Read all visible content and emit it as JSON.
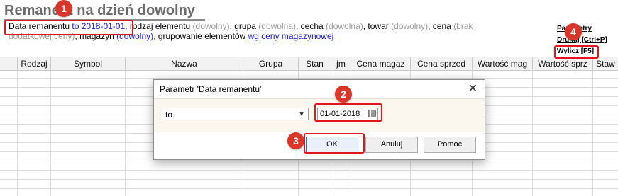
{
  "page": {
    "title": "Remanent na dzień dowolny"
  },
  "filters": {
    "date_label": "Data remanentu",
    "date_value": "to 2018-01-01",
    "rodzaj_label": "rodzaj elementu",
    "rodzaj_value": "(dowolny)",
    "grupa_label": "grupa",
    "grupa_value": "(dowolna)",
    "cecha_label": "cecha",
    "cecha_value": "(dowolna)",
    "towar_label": "towar",
    "towar_value": "(dowolny)",
    "cena_label": "cena",
    "cena_value": "(brak dodatkowej ceny)",
    "magazyn_label": "magazyn",
    "magazyn_value": "(dowolny)",
    "grupowanie_label": "grupowanie elementów",
    "grupowanie_value": "wg ceny magazynowej"
  },
  "actions": {
    "parametry": "Parametry",
    "drukuj": "Drukuj [Ctrl+P]",
    "wylicz": "Wylicz [F5]"
  },
  "table": {
    "columns": [
      "Rodzaj",
      "Symbol",
      "Nazwa",
      "Grupa",
      "Stan",
      "jm",
      "Cena magaz",
      "Cena sprzed",
      "Wartość mag",
      "Wartość sprz",
      "Staw"
    ]
  },
  "dialog": {
    "title": "Parametr 'Data remanentu'",
    "close_glyph": "✕",
    "operator_value": "to",
    "date_value": "01-01-2018",
    "ok_label": "OK",
    "cancel_label": "Anuluj",
    "help_label": "Pomoc"
  },
  "badges": [
    "1",
    "2",
    "3",
    "4"
  ],
  "colors": {
    "accent_red": "#d9372a",
    "highlight_border": "#e0161e",
    "link_blue": "#1a1ad0",
    "link_gray": "#9a9a9a"
  }
}
